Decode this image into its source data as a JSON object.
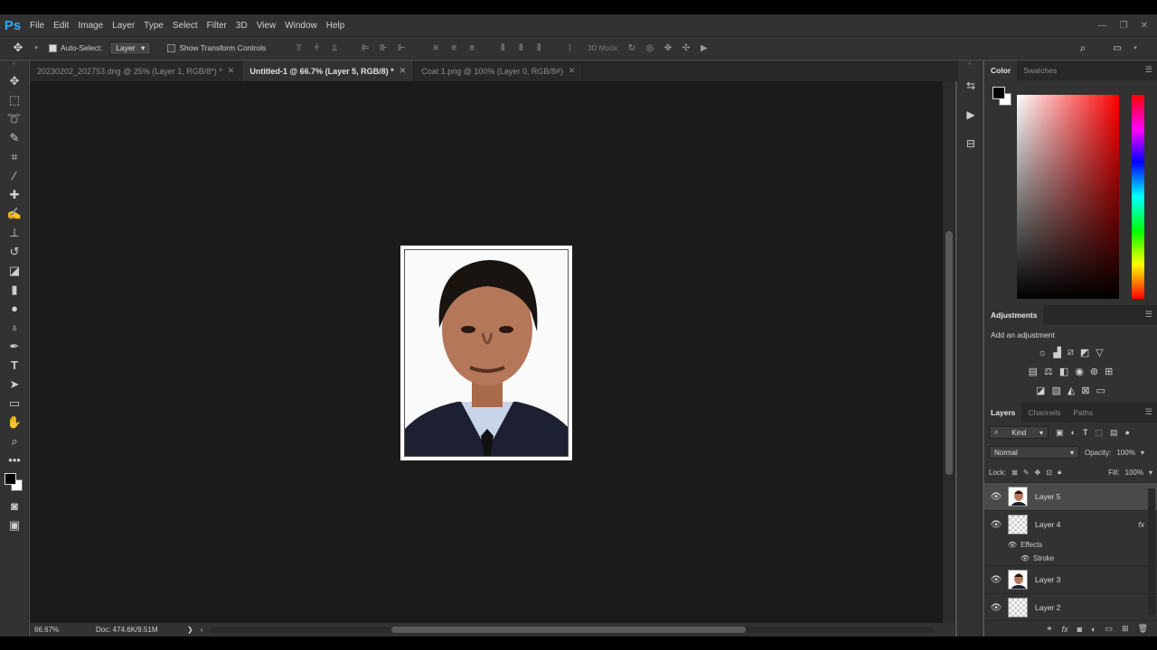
{
  "app": {
    "logo": "Ps"
  },
  "menu": [
    "File",
    "Edit",
    "Image",
    "Layer",
    "Type",
    "Select",
    "Filter",
    "3D",
    "View",
    "Window",
    "Help"
  ],
  "window_controls": {
    "minimize": "—",
    "restore": "❐",
    "close": "✕"
  },
  "options": {
    "auto_select_label": "Auto-Select:",
    "auto_select_checked": true,
    "auto_select_target": "Layer",
    "show_transform_label": "Show Transform Controls",
    "show_transform_checked": false,
    "mode_3d_label": "3D Mode:"
  },
  "tabs": [
    {
      "label": "20230202_202753.dng @ 25% (Layer 1, RGB/8*) *",
      "active": false
    },
    {
      "label": "Untitled-1 @ 66.7% (Layer 5, RGB/8) *",
      "active": true
    },
    {
      "label": "Coat 1.png @ 100% (Layer 0, RGB/8#)",
      "active": false
    }
  ],
  "tabs_close": "✕",
  "status": {
    "zoom": "66.67%",
    "doc": "Doc: 474.6K/9.51M",
    "arrow": "❯",
    "left_arrow": "‹"
  },
  "color_panel": {
    "tabs": [
      "Color",
      "Swatches"
    ],
    "fg": "#000000",
    "bg": "#ffffff"
  },
  "adjustments": {
    "tab": "Adjustments",
    "subtitle": "Add an adjustment"
  },
  "layers_panel": {
    "tabs": [
      "Layers",
      "Channels",
      "Paths"
    ],
    "filter": "Kind",
    "blend_mode": "Normal",
    "opacity_label": "Opacity:",
    "opacity": "100%",
    "lock_label": "Lock:",
    "fill_label": "Fill:",
    "fill": "100%",
    "layers": [
      {
        "name": "Layer 5",
        "selected": true,
        "thumb": "photo",
        "fx": false
      },
      {
        "name": "Layer 4",
        "selected": false,
        "thumb": "transparent",
        "fx": true
      },
      {
        "name": "Layer 3",
        "selected": false,
        "thumb": "photo",
        "fx": false
      },
      {
        "name": "Layer 2",
        "selected": false,
        "thumb": "transparent",
        "fx": false
      }
    ],
    "effects_label": "Effects",
    "stroke_label": "Stroke",
    "fx_badge": "fx"
  },
  "icons": {
    "move": "move-icon",
    "marquee": "marquee-icon",
    "lasso": "lasso-icon",
    "quick_select": "quick-select-icon",
    "crop": "crop-icon",
    "eyedropper": "eyedropper-icon",
    "healing": "healing-brush-icon",
    "brush": "brush-icon",
    "stamp": "clone-stamp-icon",
    "history_brush": "history-brush-icon",
    "eraser": "eraser-icon",
    "gradient": "gradient-icon",
    "blur": "blur-icon",
    "dodge": "dodge-icon",
    "pen": "pen-icon",
    "type": "type-icon",
    "path_select": "path-select-icon",
    "shape": "rectangle-icon",
    "hand": "hand-icon",
    "zoom": "zoom-icon",
    "more": "more-tools-icon"
  }
}
